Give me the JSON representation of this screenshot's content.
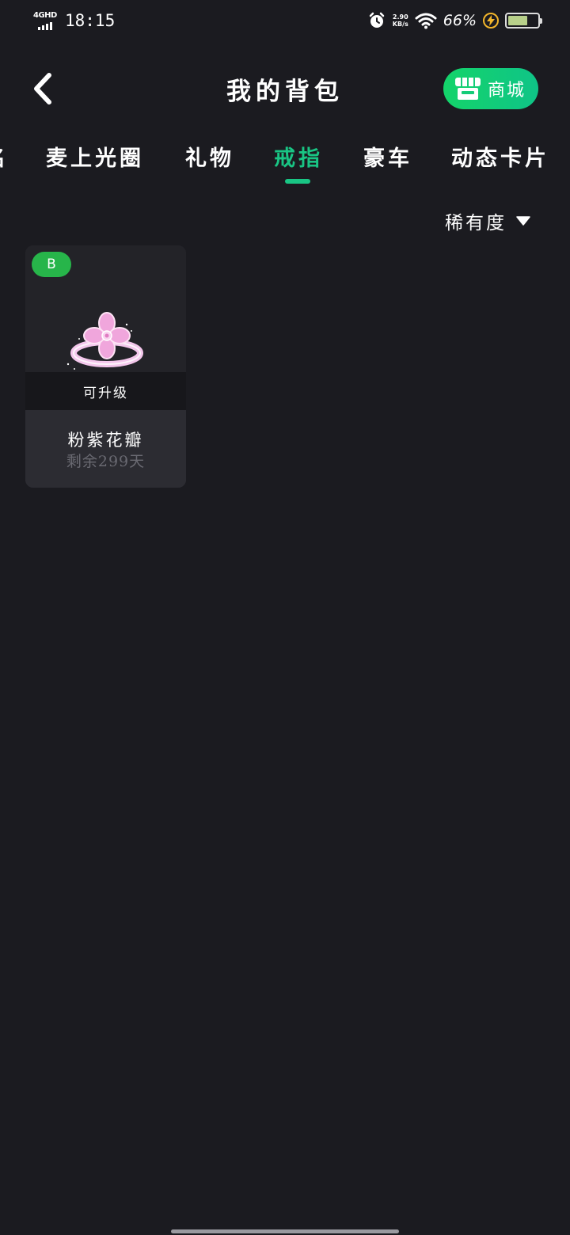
{
  "status_bar": {
    "network": "4GHD",
    "time": "18:15",
    "speed_value": "2.90",
    "speed_unit": "KB/s",
    "battery_percent": "66%",
    "battery_level": 0.66,
    "icons": [
      "signal-icon",
      "alarm-icon",
      "wifi-icon",
      "charging-icon",
      "battery-icon"
    ]
  },
  "header": {
    "title": "我的背包",
    "back_icon": "chevron-left-icon",
    "shop_button": {
      "label": "商城",
      "icon": "store-icon"
    }
  },
  "tabs": {
    "items": [
      {
        "label": "名",
        "active": false
      },
      {
        "label": "麦上光圈",
        "active": false
      },
      {
        "label": "礼物",
        "active": false
      },
      {
        "label": "戒指",
        "active": true
      },
      {
        "label": "豪车",
        "active": false
      },
      {
        "label": "动态卡片",
        "active": false
      }
    ]
  },
  "sort": {
    "label": "稀有度",
    "icon": "caret-down-icon"
  },
  "items": [
    {
      "grade": "B",
      "status": "可升级",
      "name": "粉紫花瓣",
      "remaining": "剩余299天",
      "icon": "flower-ring-icon"
    }
  ],
  "colors": {
    "background": "#1b1b20",
    "accent": "#19c584",
    "shop_gradient_start": "#14d46a",
    "shop_gradient_end": "#0fc487",
    "grade_badge": "#27b54a",
    "muted_text": "#6a6a72"
  }
}
